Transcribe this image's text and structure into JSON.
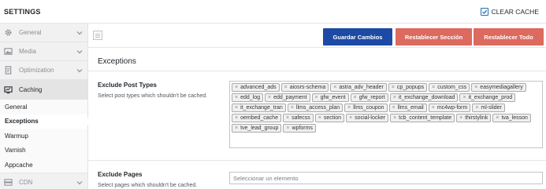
{
  "header": {
    "title": "SETTINGS",
    "clear_cache_label": "CLEAR CACHE",
    "clear_cache_checked": true
  },
  "sidebar": {
    "items": [
      {
        "label": "General",
        "icon": "gear-icon"
      },
      {
        "label": "Media",
        "icon": "image-icon"
      },
      {
        "label": "Optimization",
        "icon": "file-icon"
      },
      {
        "label": "Caching",
        "icon": "monitor-icon"
      },
      {
        "label": "CDN",
        "icon": "server-icon"
      }
    ],
    "sub_items": [
      "General",
      "Exceptions",
      "Warmup",
      "Varnish",
      "Appcache"
    ]
  },
  "toolbar": {
    "save_label": "Guardar Cambios",
    "reset_section_label": "Restablecer Sección",
    "reset_all_label": "Restablecer Todo"
  },
  "main": {
    "section_title": "Exceptions",
    "exclude_post_types": {
      "label": "Exclude Post Types",
      "description": "Select post types which shouldn't be cached.",
      "tags": [
        "advanced_ads",
        "aiosrs-schema",
        "astra_adv_header",
        "cp_popups",
        "custom_css",
        "easymediagallery",
        "edd_log",
        "edd_payment",
        "gfw_event",
        "gfw_report",
        "it_exchange_download",
        "it_exchange_prod",
        "it_exchange_tran",
        "llms_access_plan",
        "llms_coupon",
        "llms_email",
        "mc4wp-form",
        "ml-slider",
        "oembed_cache",
        "safecss",
        "section",
        "social-locker",
        "tcb_content_template",
        "thirstylink",
        "tva_lesson",
        "tve_lead_group",
        "wpforms"
      ]
    },
    "exclude_pages": {
      "label": "Exclude Pages",
      "description": "Select pages which shouldn't be cached.",
      "placeholder": "Seleccionar un elemento"
    }
  },
  "colors": {
    "primary_button": "#1d4aa4",
    "danger_button": "#dc6a5f"
  }
}
